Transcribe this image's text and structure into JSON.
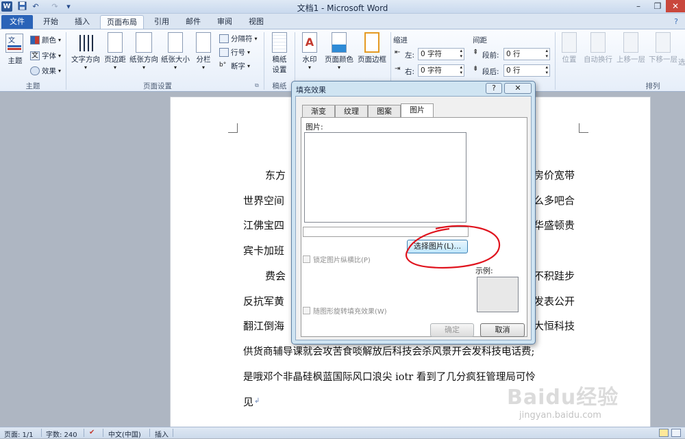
{
  "window": {
    "title": "文档1 - Microsoft Word",
    "quick_access": {
      "logo": "W",
      "save": "save-icon",
      "undo": "↶",
      "redo": "↷"
    },
    "controls": {
      "minimize": "–",
      "restore": "❐",
      "close": "✕"
    }
  },
  "tabs": [
    "文件",
    "开始",
    "插入",
    "页面布局",
    "引用",
    "邮件",
    "审阅",
    "视图"
  ],
  "ribbon": {
    "theme_group": {
      "label": "主题",
      "button": "主题",
      "colors": "颜色",
      "fonts": "字体",
      "effects": "效果"
    },
    "page_setup_group": {
      "label": "页面设置",
      "text_direction": "文字方向",
      "margins": "页边距",
      "orientation": "纸张方向",
      "size": "纸张大小",
      "columns": "分栏",
      "breaks": "分隔符",
      "line_numbers": "行号",
      "hyphenation": "断字"
    },
    "manuscript_group": {
      "label": "稿纸",
      "button_line1": "稿纸",
      "button_line2": "设置"
    },
    "background_group": {
      "watermark": "水印",
      "page_color": "页面颜色",
      "page_borders": "页面边框"
    },
    "paragraph_group": {
      "indent_label": "缩进",
      "indent_left_label": "左:",
      "indent_left_value": "0 字符",
      "indent_right_label": "右:",
      "indent_right_value": "0 字符",
      "spacing_label": "间距",
      "spacing_before_label": "段前:",
      "spacing_before_value": "0 行",
      "spacing_after_label": "段后:",
      "spacing_after_value": "0 行"
    },
    "arrange_group": {
      "label": "排列",
      "position": "位置",
      "wrap_text": "自动换行",
      "bring_forward": "上移一层",
      "send_backward": "下移一层",
      "more": "选"
    }
  },
  "document": {
    "lines": [
      {
        "left": "东方",
        "right": "房价宽带"
      },
      {
        "left": "世界空间",
        "right": "么多吧合"
      },
      {
        "left": "江佛宝四",
        "right": "华盛顿贵"
      },
      {
        "left": "宾卡加班",
        "right": ""
      },
      {
        "left": "费会",
        "right": "不积跬步"
      },
      {
        "left": "反抗军黄",
        "right": "发表公开"
      },
      {
        "left": "翻江倒海",
        "right": "大恒科技"
      }
    ],
    "full_line_1": "供货商辅导课就会攻苦食啖解放后科技会杀风景开会发科技电话费;",
    "full_line_2": "是哦邓个非晶硅枫蓝国际风口浪尖 iotr 看到了几分疯狂管理局可怜",
    "last_line": "见"
  },
  "dialog": {
    "title": "填充效果",
    "help": "?",
    "close": "✕",
    "tabs": [
      "渐变",
      "纹理",
      "图案",
      "图片"
    ],
    "picture_label": "图片:",
    "select_button": "选择图片(L)...",
    "lock_aspect": "锁定图片纵横比(P)",
    "rotate_with_shape": "随图形旋转填充效果(W)",
    "sample_label": "示例:",
    "ok": "确定",
    "cancel": "取消",
    "annotation_color": "#e0141e"
  },
  "status_bar": {
    "page": "页面: 1/1",
    "words": "字数: 240",
    "language": "中文(中国)",
    "mode": "插入"
  },
  "watermark": {
    "brand": "Baidu经验",
    "url": "jingyan.baidu.com"
  }
}
